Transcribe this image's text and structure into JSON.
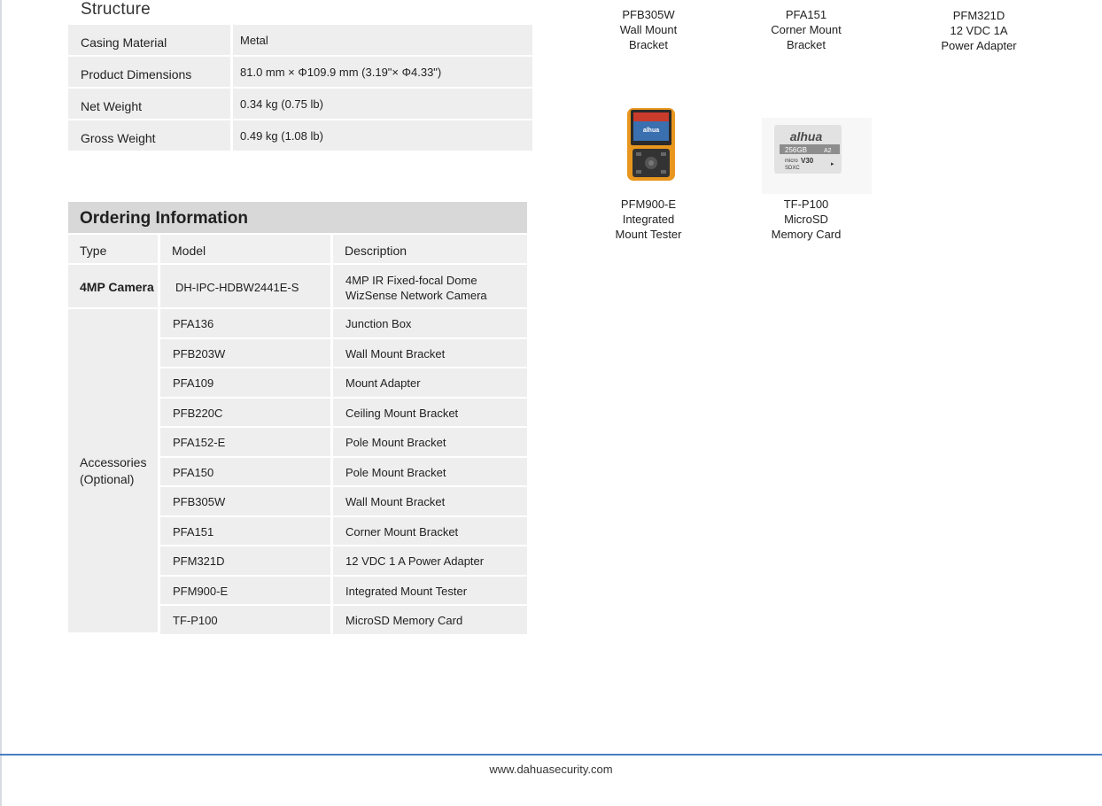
{
  "structure": {
    "title": "Structure",
    "rows": [
      {
        "label": "Casing Material",
        "value": "Metal"
      },
      {
        "label": "Product Dimensions",
        "value": "81.0 mm × Φ109.9 mm (3.19\"× Φ4.33\")"
      },
      {
        "label": "Net Weight",
        "value": "0.34 kg (0.75 lb)"
      },
      {
        "label": "Gross Weight",
        "value": "0.49 kg (1.08 lb)"
      }
    ]
  },
  "ordering": {
    "title": "Ordering Information",
    "headers": {
      "type": "Type",
      "model": "Model",
      "description": "Description"
    },
    "camera": {
      "type": "4MP Camera",
      "model": "DH-IPC-HDBW2441E-S",
      "description_line1": "4MP IR Fixed-focal Dome",
      "description_line2": "WizSense Network Camera"
    },
    "accessories_label_line1": "Accessories",
    "accessories_label_line2": "(Optional)",
    "accessories": [
      {
        "model": "PFA136",
        "description": "Junction Box"
      },
      {
        "model": "PFB203W",
        "description": "Wall Mount Bracket"
      },
      {
        "model": "PFA109",
        "description": "Mount Adapter"
      },
      {
        "model": "PFB220C",
        "description": "Ceiling Mount Bracket"
      },
      {
        "model": "PFA152-E",
        "description": "Pole Mount Bracket"
      },
      {
        "model": "PFA150",
        "description": "Pole Mount Bracket"
      },
      {
        "model": "PFB305W",
        "description": "Wall Mount Bracket"
      },
      {
        "model": "PFA151",
        "description": "Corner Mount Bracket"
      },
      {
        "model": "PFM321D",
        "description": "12 VDC 1 A Power Adapter"
      },
      {
        "model": "PFM900-E",
        "description": "Integrated Mount Tester"
      },
      {
        "model": "TF-P100",
        "description": "MicroSD Memory Card"
      }
    ]
  },
  "products": [
    {
      "l1": "PFB305W",
      "l2": "Wall Mount",
      "l3": "Bracket"
    },
    {
      "l1": "PFA151",
      "l2": "Corner Mount",
      "l3": "Bracket"
    },
    {
      "l1": "PFM321D",
      "l2": "12 VDC 1A",
      "l3": "Power Adapter"
    },
    {
      "l1": "PFM900-E",
      "l2": "Integrated",
      "l3": "Mount Tester"
    },
    {
      "l1": "TF-P100",
      "l2": "MicroSD",
      "l3": "Memory Card"
    }
  ],
  "sd_card": {
    "brand": "alhua",
    "capacity": "256GB",
    "speed": "V30",
    "class": "A2",
    "micro": "micro",
    "sdxc": "SDXC"
  },
  "tester_brand": "alhua",
  "footer": {
    "url": "www.dahuasecurity.com"
  },
  "colors": {
    "footer_line": "#4a7fc1",
    "cell_bg": "#eeeeee",
    "header_bg": "#d8d8d8"
  }
}
